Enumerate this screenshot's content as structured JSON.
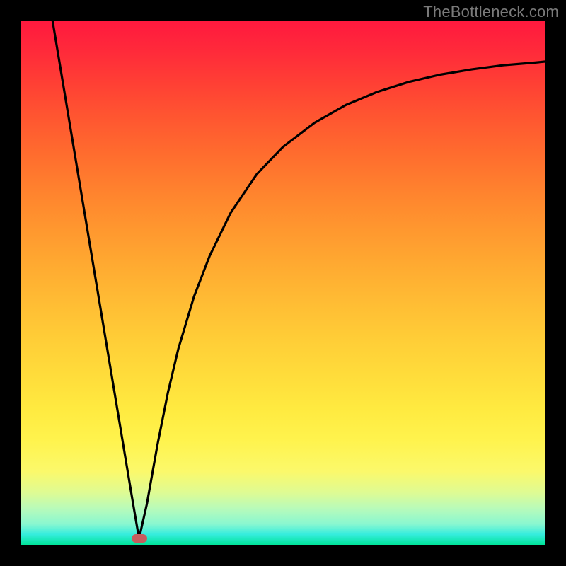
{
  "watermark": "TheBottleneck.com",
  "marker": {
    "color": "#c65e5e",
    "x_frac": 0.225,
    "y_frac": 0.988
  },
  "chart_data": {
    "type": "line",
    "title": "",
    "xlabel": "",
    "ylabel": "",
    "xlim": [
      0,
      1
    ],
    "ylim": [
      0,
      1
    ],
    "grid": false,
    "legend": false,
    "annotations": [],
    "series": [
      {
        "name": "curve",
        "color": "#000000",
        "x": [
          0.06,
          0.08,
          0.1,
          0.12,
          0.14,
          0.16,
          0.18,
          0.2,
          0.212,
          0.225,
          0.24,
          0.26,
          0.28,
          0.3,
          0.33,
          0.36,
          0.4,
          0.45,
          0.5,
          0.56,
          0.62,
          0.68,
          0.74,
          0.8,
          0.86,
          0.92,
          0.98,
          1.0
        ],
        "y": [
          1.0,
          0.88,
          0.76,
          0.64,
          0.52,
          0.4,
          0.28,
          0.16,
          0.088,
          0.012,
          0.078,
          0.19,
          0.29,
          0.374,
          0.474,
          0.552,
          0.634,
          0.708,
          0.76,
          0.806,
          0.84,
          0.865,
          0.884,
          0.898,
          0.908,
          0.916,
          0.921,
          0.923
        ]
      }
    ]
  }
}
